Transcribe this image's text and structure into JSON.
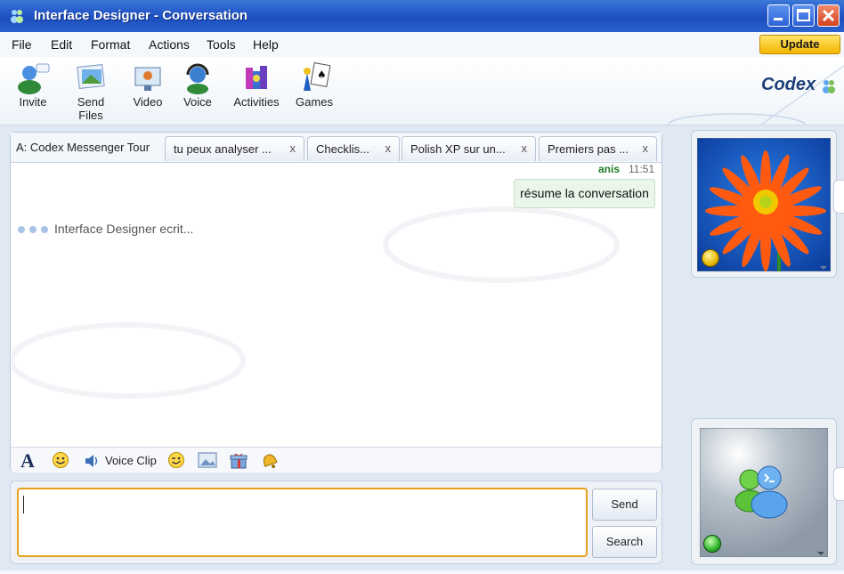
{
  "window": {
    "title": "Interface Designer - Conversation"
  },
  "menu": [
    "File",
    "Edit",
    "Format",
    "Actions",
    "Tools",
    "Help"
  ],
  "update_label": "Update",
  "toolbar": {
    "invite": "Invite",
    "send_files": "Send Files",
    "video": "Video",
    "voice": "Voice",
    "activities": "Activities",
    "games": "Games"
  },
  "brand": "Codex",
  "tabs": {
    "active": "A: Codex Messenger Tour",
    "items": [
      {
        "label": "tu peux analyser ...",
        "close": "x"
      },
      {
        "label": "Checklis...",
        "close": "x"
      },
      {
        "label": "Polish XP sur un...",
        "close": "x"
      },
      {
        "label": "Premiers pas ...",
        "close": "x"
      }
    ]
  },
  "messages": [
    {
      "sender": "anis",
      "time": "11:51",
      "text": "résume la conversation"
    }
  ],
  "typing_text": "Interface Designer ecrit...",
  "format_bar": {
    "voice_clip": "Voice Clip"
  },
  "input": {
    "value": ""
  },
  "buttons": {
    "send": "Send",
    "search": "Search"
  },
  "colors": {
    "title_bar": "#2458c8",
    "accent_input": "#e7a11a",
    "status_away": "#e8b800",
    "status_online": "#2fb42a"
  }
}
